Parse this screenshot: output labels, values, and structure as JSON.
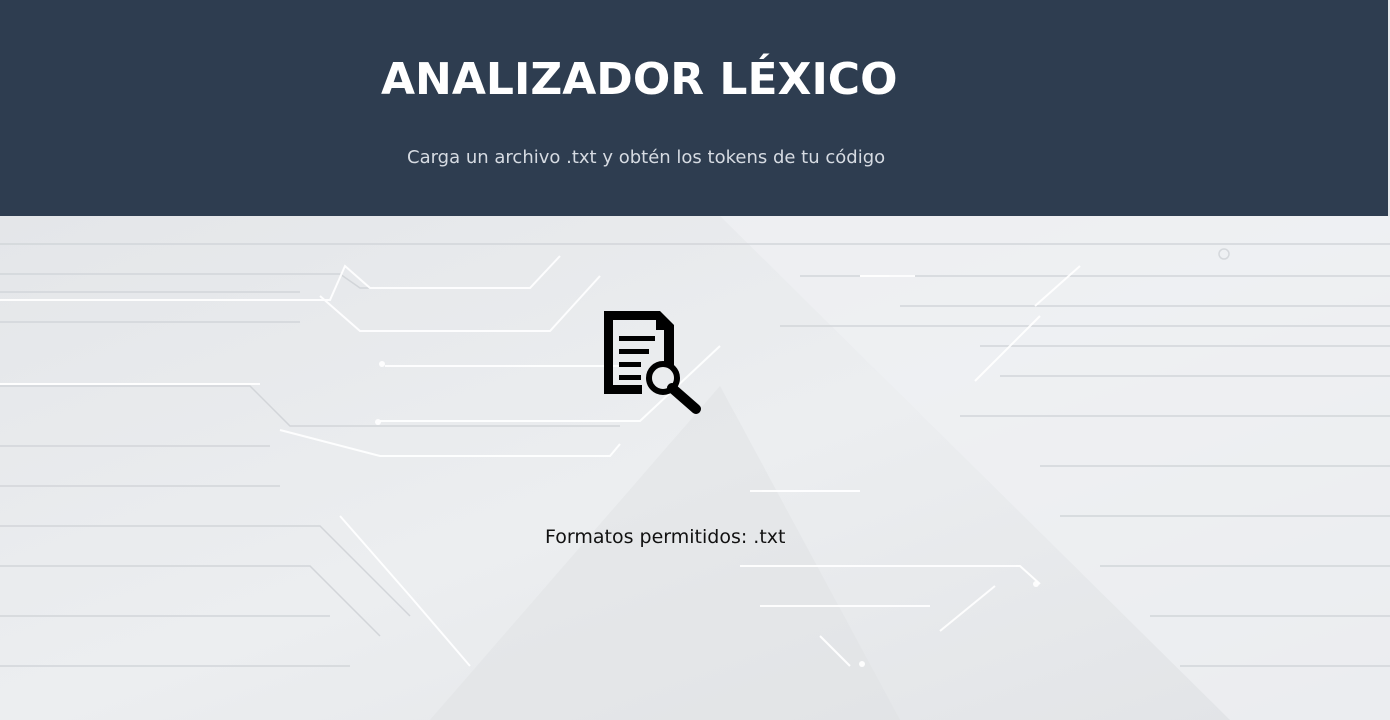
{
  "header": {
    "title": "ANALIZADOR LÉXICO",
    "subtitle": "Carga un archivo .txt y obtén los tokens de tu código"
  },
  "upload": {
    "icon": "document-search-icon",
    "formats_text": "Formatos permitidos: .txt"
  },
  "colors": {
    "header_bg": "#2e3d50",
    "title": "#ffffff",
    "subtitle": "#d6dbe2",
    "page_bg": "#e8eaec",
    "text": "#111111"
  }
}
